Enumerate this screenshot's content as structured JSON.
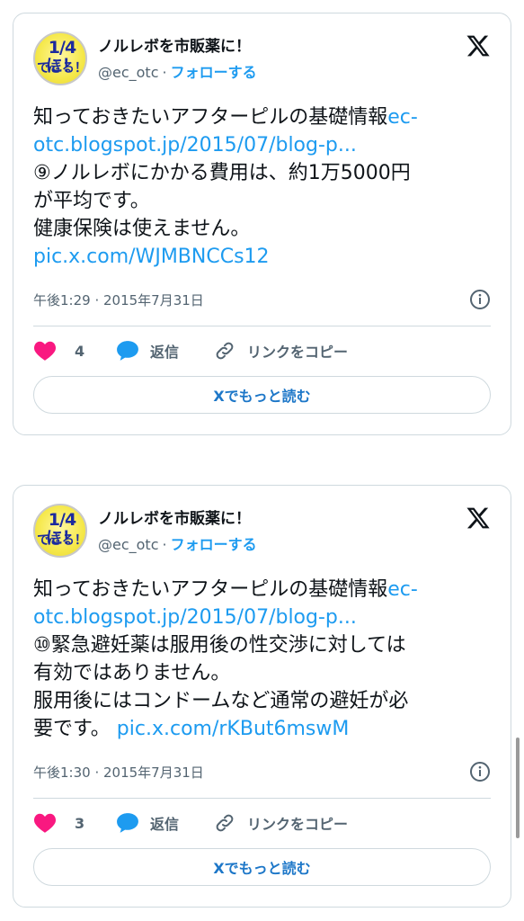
{
  "tweets": [
    {
      "author_name": "ノルレボを市販薬に！",
      "avatar_text_1": "1/4に！",
      "avatar_text_2": "できる！",
      "handle": "@ec_otc",
      "separator": "·",
      "follow_label": "フォローする",
      "lines": [
        {
          "text": "知っておきたいアフターピルの基礎情報",
          "link": "ec-"
        },
        {
          "text": "",
          "link": "otc.blogspot.jp/2015/07/blog-p..."
        },
        {
          "text": "⑨ノルレボにかかる費用は、約1万5000円",
          "link": ""
        },
        {
          "text": "が平均です。",
          "link": ""
        },
        {
          "text": "健康保険は使えません。",
          "link": ""
        },
        {
          "text": "",
          "link": "pic.x.com/WJMBNCCs12"
        }
      ],
      "timestamp": "午後1:29 · 2015年7月31日",
      "like_count": "4",
      "reply_label": "返信",
      "copy_link_label": "リンクをコピー",
      "read_more_label": "Xでもっと読む"
    },
    {
      "author_name": "ノルレボを市販薬に！",
      "avatar_text_1": "1/4に！",
      "avatar_text_2": "できる！",
      "handle": "@ec_otc",
      "separator": "·",
      "follow_label": "フォローする",
      "lines": [
        {
          "text": "知っておきたいアフターピルの基礎情報",
          "link": "ec-"
        },
        {
          "text": "",
          "link": "otc.blogspot.jp/2015/07/blog-p..."
        },
        {
          "text": "⑩緊急避妊薬は服用後の性交渉に対しては",
          "link": ""
        },
        {
          "text": "有効ではありません。",
          "link": ""
        },
        {
          "text": "服用後にはコンドームなど通常の避妊が必",
          "link": ""
        },
        {
          "text": "要です。 ",
          "link": "pic.x.com/rKBut6mswM"
        }
      ],
      "timestamp": "午後1:30 · 2015年7月31日",
      "like_count": "3",
      "reply_label": "返信",
      "copy_link_label": "リンクをコピー",
      "read_more_label": "Xでもっと読む"
    }
  ],
  "colors": {
    "accent": "#1d9bf0",
    "like": "#f91880",
    "reply": "#1d9bf0",
    "muted": "#536471",
    "border": "#cfd9de"
  },
  "icons": [
    "x-logo-icon",
    "info-icon",
    "heart-icon",
    "reply-bubble-icon",
    "link-icon"
  ]
}
